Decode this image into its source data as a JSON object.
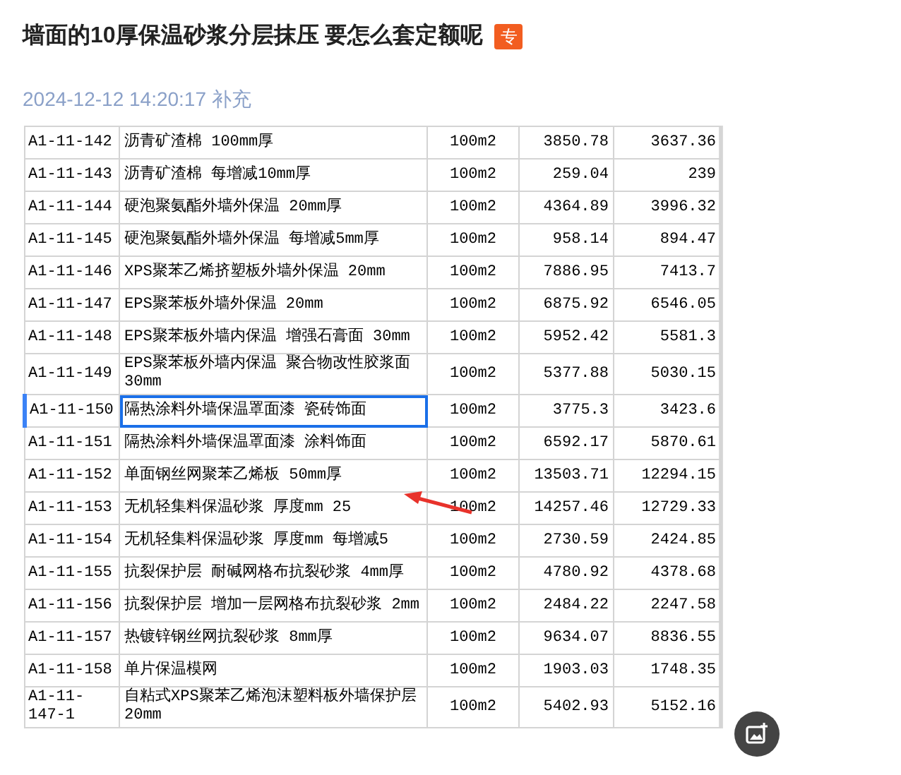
{
  "question": {
    "title": "墙面的10厚保温砂浆分层抹压 要怎么套定额呢",
    "badge": "专",
    "time": "2024-12-12 14:20:17",
    "time_note": "补充"
  },
  "table": {
    "rows": [
      {
        "code": "A1-11-142",
        "name": "沥青矿渣棉 100mm厚",
        "unit": "100m2",
        "price_1": "3850.78",
        "price_2": "3637.36",
        "selected": false
      },
      {
        "code": "A1-11-143",
        "name": "沥青矿渣棉 每增减10mm厚",
        "unit": "100m2",
        "price_1": "259.04",
        "price_2": "239",
        "selected": false
      },
      {
        "code": "A1-11-144",
        "name": "硬泡聚氨酯外墙外保温 20mm厚",
        "unit": "100m2",
        "price_1": "4364.89",
        "price_2": "3996.32",
        "selected": false
      },
      {
        "code": "A1-11-145",
        "name": "硬泡聚氨酯外墙外保温 每增减5mm厚",
        "unit": "100m2",
        "price_1": "958.14",
        "price_2": "894.47",
        "selected": false
      },
      {
        "code": "A1-11-146",
        "name": "XPS聚苯乙烯挤塑板外墙外保温 20mm",
        "unit": "100m2",
        "price_1": "7886.95",
        "price_2": "7413.7",
        "selected": false
      },
      {
        "code": "A1-11-147",
        "name": "EPS聚苯板外墙外保温 20mm",
        "unit": "100m2",
        "price_1": "6875.92",
        "price_2": "6546.05",
        "selected": false
      },
      {
        "code": "A1-11-148",
        "name": "EPS聚苯板外墙内保温 增强石膏面 30mm",
        "unit": "100m2",
        "price_1": "5952.42",
        "price_2": "5581.3",
        "selected": false
      },
      {
        "code": "A1-11-149",
        "name": "EPS聚苯板外墙内保温 聚合物改性胶浆面 30mm",
        "unit": "100m2",
        "price_1": "5377.88",
        "price_2": "5030.15",
        "selected": false
      },
      {
        "code": "A1-11-150",
        "name": "隔热涂料外墙保温罩面漆 瓷砖饰面",
        "unit": "100m2",
        "price_1": "3775.3",
        "price_2": "3423.6",
        "selected": true
      },
      {
        "code": "A1-11-151",
        "name": "隔热涂料外墙保温罩面漆 涂料饰面",
        "unit": "100m2",
        "price_1": "6592.17",
        "price_2": "5870.61",
        "selected": false
      },
      {
        "code": "A1-11-152",
        "name": "单面钢丝网聚苯乙烯板 50mm厚",
        "unit": "100m2",
        "price_1": "13503.71",
        "price_2": "12294.15",
        "selected": false
      },
      {
        "code": "A1-11-153",
        "name": "无机轻集料保温砂浆 厚度mm 25",
        "unit": "100m2",
        "price_1": "14257.46",
        "price_2": "12729.33",
        "selected": false,
        "arrow": true
      },
      {
        "code": "A1-11-154",
        "name": "无机轻集料保温砂浆 厚度mm 每增减5",
        "unit": "100m2",
        "price_1": "2730.59",
        "price_2": "2424.85",
        "selected": false
      },
      {
        "code": "A1-11-155",
        "name": "抗裂保护层 耐碱网格布抗裂砂浆 4mm厚",
        "unit": "100m2",
        "price_1": "4780.92",
        "price_2": "4378.68",
        "selected": false
      },
      {
        "code": "A1-11-156",
        "name": "抗裂保护层 增加一层网格布抗裂砂浆 2mm",
        "unit": "100m2",
        "price_1": "2484.22",
        "price_2": "2247.58",
        "selected": false
      },
      {
        "code": "A1-11-157",
        "name": "热镀锌钢丝网抗裂砂浆 8mm厚",
        "unit": "100m2",
        "price_1": "9634.07",
        "price_2": "8836.55",
        "selected": false
      },
      {
        "code": "A1-11-158",
        "name": "单片保温模网",
        "unit": "100m2",
        "price_1": "1903.03",
        "price_2": "1748.35",
        "selected": false
      },
      {
        "code": "A1-11-147-1",
        "name": "自粘式XPS聚苯乙烯泡沫塑料板外墙保护层 20mm",
        "unit": "100m2",
        "price_1": "5402.93",
        "price_2": "5152.16",
        "selected": false
      }
    ]
  }
}
